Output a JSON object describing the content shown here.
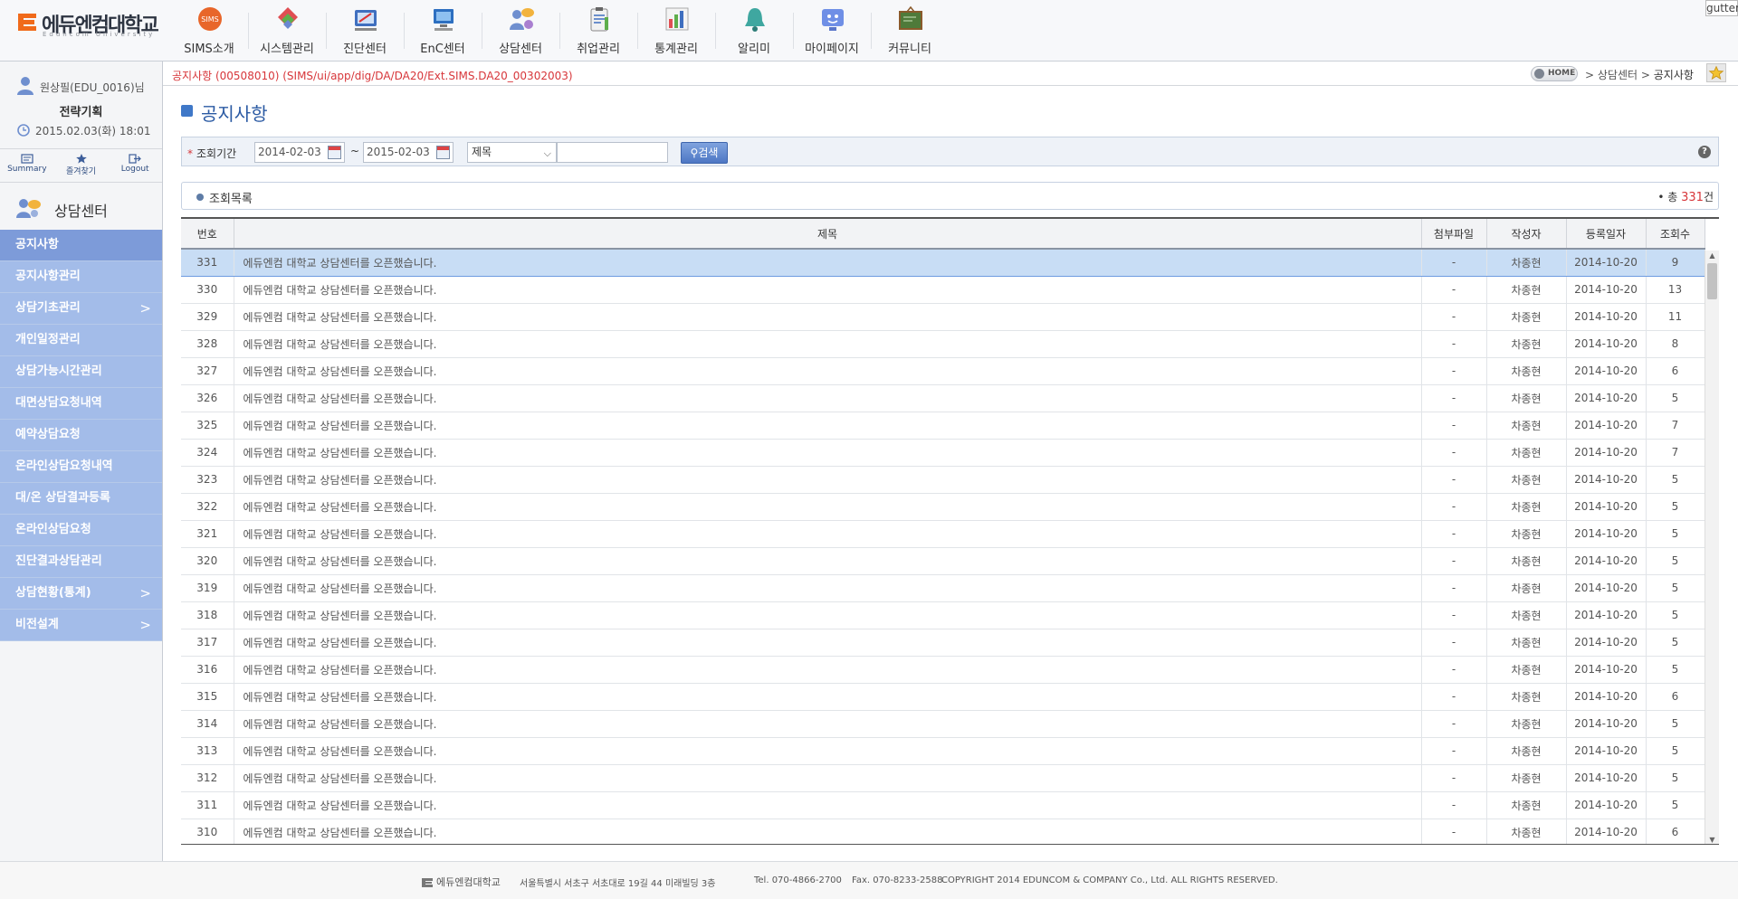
{
  "header": {
    "logo_text": "에듀엔컴대학교",
    "logo_sub": "Eduncom University",
    "gutter": "gutter",
    "nav": [
      {
        "label": "SIMS소개",
        "icon": "sims-badge-icon"
      },
      {
        "label": "시스템관리",
        "icon": "system-icon"
      },
      {
        "label": "진단센터",
        "icon": "diagnosis-icon"
      },
      {
        "label": "EnC센터",
        "icon": "computer-icon"
      },
      {
        "label": "상담센터",
        "icon": "counseling-icon"
      },
      {
        "label": "취업관리",
        "icon": "clipboard-icon"
      },
      {
        "label": "통계관리",
        "icon": "bar-chart-icon"
      },
      {
        "label": "알리미",
        "icon": "bell-icon"
      },
      {
        "label": "마이페이지",
        "icon": "monitor-face-icon"
      },
      {
        "label": "커뮤니티",
        "icon": "board-icon"
      }
    ]
  },
  "user": {
    "name": "원상필(EDU_0016)님",
    "dept": "전략기획",
    "datetime": "2015.02.03(화) 18:01"
  },
  "quicklinks": [
    {
      "label": "Summary",
      "icon": "summary-icon"
    },
    {
      "label": "즐겨찾기",
      "icon": "star-icon"
    },
    {
      "label": "Logout",
      "icon": "logout-icon"
    }
  ],
  "sidebar": {
    "title": "상담센터",
    "items": [
      {
        "label": "공지사항",
        "active": true,
        "submenu": false
      },
      {
        "label": "공지사항관리",
        "active": false,
        "submenu": false
      },
      {
        "label": "상담기초관리",
        "active": false,
        "submenu": true
      },
      {
        "label": "개인일정관리",
        "active": false,
        "submenu": false
      },
      {
        "label": "상담가능시간관리",
        "active": false,
        "submenu": false
      },
      {
        "label": "대면상담요청내역",
        "active": false,
        "submenu": false
      },
      {
        "label": "예약상담요청",
        "active": false,
        "submenu": false
      },
      {
        "label": "온라인상담요청내역",
        "active": false,
        "submenu": false
      },
      {
        "label": "대/온 상담결과등록",
        "active": false,
        "submenu": false
      },
      {
        "label": "온라인상담요청",
        "active": false,
        "submenu": false
      },
      {
        "label": "진단결과상담관리",
        "active": false,
        "submenu": false
      },
      {
        "label": "상담현황(통계)",
        "active": false,
        "submenu": true
      },
      {
        "label": "비전설계",
        "active": false,
        "submenu": true
      }
    ]
  },
  "crumbbar": {
    "screen_id": "공지사항 (00508010) (SIMS/ui/app/dig/DA/DA20/Ext.SIMS.DA20_00302003)",
    "home": "HOME",
    "path": "> 상담센터 >",
    "current": "공지사항"
  },
  "page": {
    "title": "공지사항"
  },
  "search": {
    "label": "조회기간",
    "date_from": "2014-02-03",
    "tilde": "~",
    "date_to": "2015-02-03",
    "field": "제목",
    "keyword": "",
    "button": "검색",
    "help": "?"
  },
  "list": {
    "title": "조회목록",
    "total_prefix": "• 총",
    "total_count": "331",
    "total_suffix": "건",
    "columns": [
      "번호",
      "제목",
      "첨부파일",
      "작성자",
      "등록일자",
      "조회수"
    ],
    "rows": [
      [
        "331",
        "에듀엔컴 대학교 상담센터를 오픈했습니다.",
        "-",
        "차종현",
        "2014-10-20",
        "9"
      ],
      [
        "330",
        "에듀엔컴 대학교 상담센터를 오픈했습니다.",
        "-",
        "차종현",
        "2014-10-20",
        "13"
      ],
      [
        "329",
        "에듀엔컴 대학교 상담센터를 오픈했습니다.",
        "-",
        "차종현",
        "2014-10-20",
        "11"
      ],
      [
        "328",
        "에듀엔컴 대학교 상담센터를 오픈했습니다.",
        "-",
        "차종현",
        "2014-10-20",
        "8"
      ],
      [
        "327",
        "에듀엔컴 대학교 상담센터를 오픈했습니다.",
        "-",
        "차종현",
        "2014-10-20",
        "6"
      ],
      [
        "326",
        "에듀엔컴 대학교 상담센터를 오픈했습니다.",
        "-",
        "차종현",
        "2014-10-20",
        "5"
      ],
      [
        "325",
        "에듀엔컴 대학교 상담센터를 오픈했습니다.",
        "-",
        "차종현",
        "2014-10-20",
        "7"
      ],
      [
        "324",
        "에듀엔컴 대학교 상담센터를 오픈했습니다.",
        "-",
        "차종현",
        "2014-10-20",
        "7"
      ],
      [
        "323",
        "에듀엔컴 대학교 상담센터를 오픈했습니다.",
        "-",
        "차종현",
        "2014-10-20",
        "5"
      ],
      [
        "322",
        "에듀엔컴 대학교 상담센터를 오픈했습니다.",
        "-",
        "차종현",
        "2014-10-20",
        "5"
      ],
      [
        "321",
        "에듀엔컴 대학교 상담센터를 오픈했습니다.",
        "-",
        "차종현",
        "2014-10-20",
        "5"
      ],
      [
        "320",
        "에듀엔컴 대학교 상담센터를 오픈했습니다.",
        "-",
        "차종현",
        "2014-10-20",
        "5"
      ],
      [
        "319",
        "에듀엔컴 대학교 상담센터를 오픈했습니다.",
        "-",
        "차종현",
        "2014-10-20",
        "5"
      ],
      [
        "318",
        "에듀엔컴 대학교 상담센터를 오픈했습니다.",
        "-",
        "차종현",
        "2014-10-20",
        "5"
      ],
      [
        "317",
        "에듀엔컴 대학교 상담센터를 오픈했습니다.",
        "-",
        "차종현",
        "2014-10-20",
        "5"
      ],
      [
        "316",
        "에듀엔컴 대학교 상담센터를 오픈했습니다.",
        "-",
        "차종현",
        "2014-10-20",
        "5"
      ],
      [
        "315",
        "에듀엔컴 대학교 상담센터를 오픈했습니다.",
        "-",
        "차종현",
        "2014-10-20",
        "6"
      ],
      [
        "314",
        "에듀엔컴 대학교 상담센터를 오픈했습니다.",
        "-",
        "차종현",
        "2014-10-20",
        "5"
      ],
      [
        "313",
        "에듀엔컴 대학교 상담센터를 오픈했습니다.",
        "-",
        "차종현",
        "2014-10-20",
        "5"
      ],
      [
        "312",
        "에듀엔컴 대학교 상담센터를 오픈했습니다.",
        "-",
        "차종현",
        "2014-10-20",
        "5"
      ],
      [
        "311",
        "에듀엔컴 대학교 상담센터를 오픈했습니다.",
        "-",
        "차종현",
        "2014-10-20",
        "5"
      ],
      [
        "310",
        "에듀엔컴 대학교 상담센터를 오픈했습니다.",
        "-",
        "차종현",
        "2014-10-20",
        "6"
      ]
    ],
    "selected_index": 0
  },
  "footer": {
    "logo": "에듀엔컴대학교",
    "address": "서울특별시 서초구 서초대로 19길 44 미래빌딩 3층",
    "tel": "Tel. 070-4866-2700",
    "fax": "Fax. 070-8233-2588",
    "copyright": "COPYRIGHT 2014 EDUNCOM & COMPANY Co., Ltd. ALL RIGHTS RESERVED."
  },
  "colors": {
    "menu_bg": "#a3bce9",
    "menu_active": "#7d9bd9",
    "accent_red": "#d7363a",
    "title_blue": "#2b5aa3",
    "selected_row": "#c8ddf5"
  }
}
